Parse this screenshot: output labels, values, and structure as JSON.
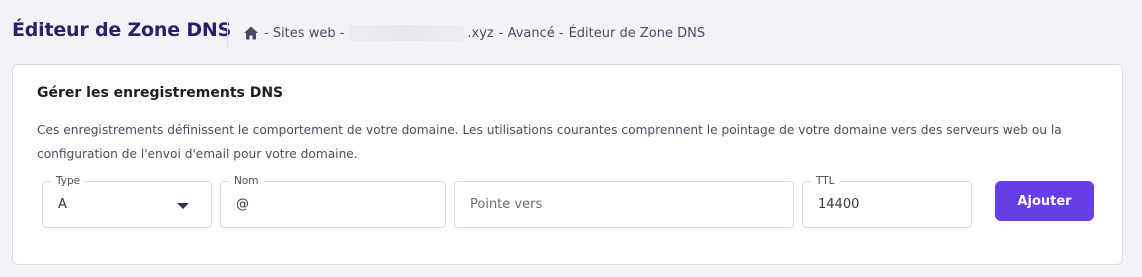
{
  "header": {
    "title": "Éditeur de Zone DNS",
    "breadcrumb": {
      "home_icon": "home-icon",
      "sep1": "- Sites web -",
      "domain_suffix": ".xyz",
      "sep2": "- Avancé -",
      "current": "Éditeur de Zone DNS"
    }
  },
  "card": {
    "title": "Gérer les enregistrements DNS",
    "description": "Ces enregistrements définissent le comportement de votre domaine. Les utilisations courantes comprennent le pointage de votre domaine vers des serveurs web ou la configuration de l'envoi d'email pour votre domaine.",
    "form": {
      "type": {
        "label": "Type",
        "value": "A"
      },
      "name": {
        "label": "Nom",
        "value": "@"
      },
      "points_to": {
        "placeholder": "Pointe vers"
      },
      "ttl": {
        "label": "TTL",
        "value": "14400"
      },
      "add_button": "Ajouter"
    }
  },
  "colors": {
    "accent": "#673de6",
    "title": "#2f1c6a",
    "background": "#f2f3f6"
  }
}
